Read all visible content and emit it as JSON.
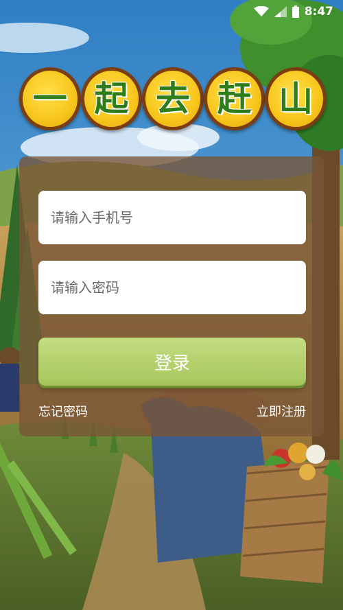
{
  "status_bar": {
    "time": "8:47",
    "icons": [
      "wifi-icon",
      "signal-icon",
      "battery-icon"
    ]
  },
  "title": {
    "characters": [
      "一",
      "起",
      "去",
      "赶",
      "山"
    ]
  },
  "login_form": {
    "phone_placeholder": "请输入手机号",
    "password_placeholder": "请输入密码",
    "login_label": "登录",
    "forgot_password_label": "忘记密码",
    "register_label": "立即注册"
  },
  "colors": {
    "sky": "#4b9ad6",
    "panel": "#785436",
    "title_coin": "#f7c51b",
    "title_text": "#2f7d1a",
    "login_button": "#b5d16e"
  }
}
